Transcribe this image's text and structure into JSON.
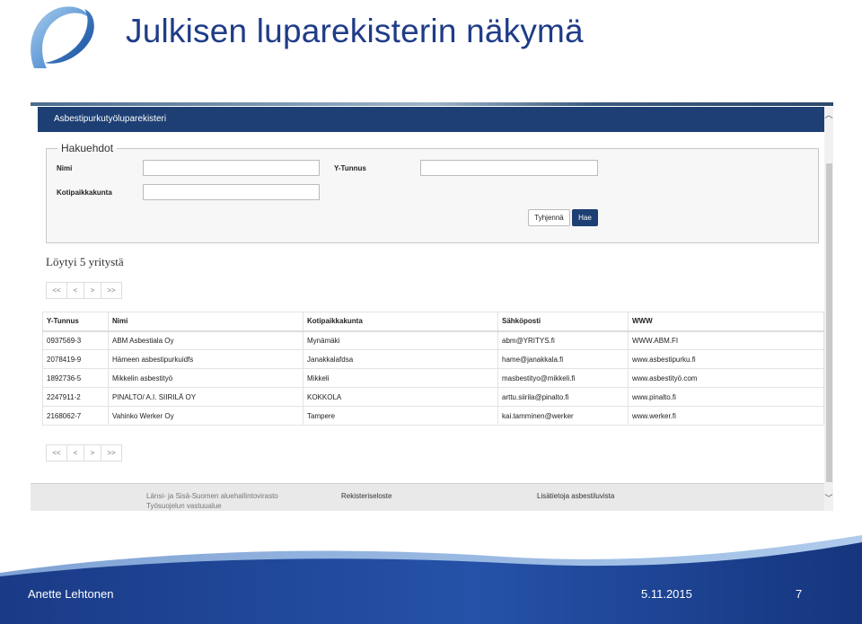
{
  "slide": {
    "title": "Julkisen luparekisterin näkymä",
    "author": "Anette Lehtonen",
    "date": "5.11.2015",
    "page_number": "7"
  },
  "app": {
    "header_title": "Asbestipurkutyöluparekisteri",
    "search": {
      "legend": "Hakuehdot",
      "name_label": "Nimi",
      "name_value": "",
      "ytunnus_label": "Y-Tunnus",
      "ytunnus_value": "",
      "kotipaikka_label": "Kotipaikkakunta",
      "kotipaikka_value": "",
      "clear_button": "Tyhjennä",
      "search_button": "Hae"
    },
    "result_count": "Löytyi 5 yritystä",
    "pager": {
      "first": "<<",
      "prev": "<",
      "next": ">",
      "last": ">>"
    },
    "table": {
      "columns": [
        "Y-Tunnus",
        "Nimi",
        "Kotipaikkakunta",
        "Sähköposti",
        "WWW"
      ],
      "rows": [
        [
          "0937569-3",
          "ABM Asbestiala Oy",
          "Mynämäki",
          "abm@YRITYS.fi",
          "WWW.ABM.FI"
        ],
        [
          "2078419-9",
          "Hämeen asbestipurkuidfs",
          "Janakkalafdsa",
          "hame@janakkala.fi",
          "www.asbestipurku.fi"
        ],
        [
          "1892736-5",
          "Mikkelin asbestityö",
          "Mikkeli",
          "masbestityo@mikkeli.fi",
          "www.asbestityö.com"
        ],
        [
          "2247911-2",
          "PINALTO/ A.I. SIIRILÄ OY",
          "KOKKOLA",
          "arttu.siirila@pinalto.fi",
          "www.pinalto.fi"
        ],
        [
          "2168062-7",
          "Vahinko Werker Oy",
          "Tampere",
          "kai.tamminen@werker",
          "www.werker.fi"
        ]
      ]
    },
    "footer": {
      "org_line1": "Länsi- ja Sisä-Suomen aluehallintovirasto",
      "org_line2": "Työsuojelun vastuualue",
      "register_link": "Rekisteriseloste",
      "info_link": "Lisätietoja asbestiluvista"
    }
  },
  "colors": {
    "title": "#1f3c88",
    "app_header": "#1d3f73",
    "wave_dark": "#1e3f8a",
    "wave_light": "#6e9bd3"
  },
  "icons": {
    "logo": "avi-logo-icon",
    "scroll_up": "chevron-up-icon",
    "scroll_down": "chevron-down-icon"
  }
}
